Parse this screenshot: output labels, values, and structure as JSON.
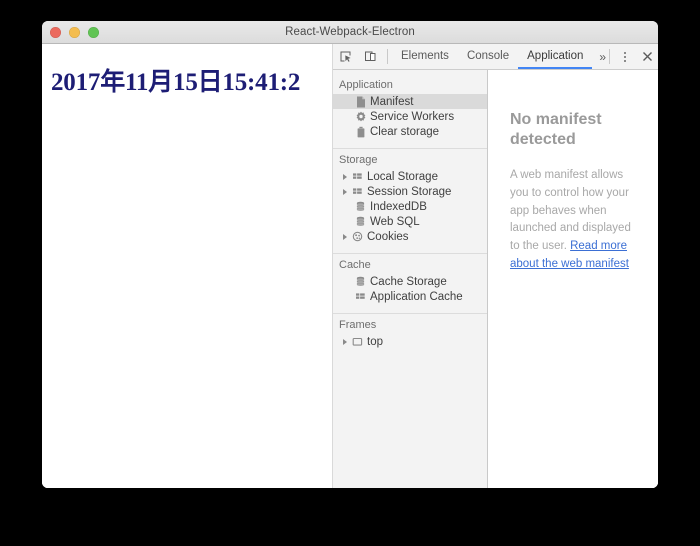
{
  "window": {
    "title": "React-Webpack-Electron",
    "traffic_lights": [
      {
        "name": "close",
        "color": "#eb6a5e"
      },
      {
        "name": "minimize",
        "color": "#f4bd4f"
      },
      {
        "name": "maximize",
        "color": "#61c454"
      }
    ]
  },
  "app": {
    "clock_text": "2017年11月15日15:41:2",
    "clock_color": "#1d1d75"
  },
  "devtools": {
    "toolbar": {
      "inspect_icon": "inspect-element-icon",
      "device_icon": "device-toolbar-icon",
      "more_tabs_label": "»",
      "kebab_label": "more-options",
      "close_label": "✕"
    },
    "tabs": [
      {
        "label": "Elements",
        "active": false
      },
      {
        "label": "Console",
        "active": false
      },
      {
        "label": "Application",
        "active": true
      }
    ],
    "accent_color": "#4285f4",
    "sidebar": [
      {
        "title": "Application",
        "items": [
          {
            "label": "Manifest",
            "icon": "document-icon",
            "arrow": false,
            "selected": true
          },
          {
            "label": "Service Workers",
            "icon": "gear-icon",
            "arrow": false,
            "selected": false
          },
          {
            "label": "Clear storage",
            "icon": "trash-icon",
            "arrow": false,
            "selected": false
          }
        ]
      },
      {
        "title": "Storage",
        "items": [
          {
            "label": "Local Storage",
            "icon": "table-icon",
            "arrow": true,
            "selected": false
          },
          {
            "label": "Session Storage",
            "icon": "table-icon",
            "arrow": true,
            "selected": false
          },
          {
            "label": "IndexedDB",
            "icon": "database-icon",
            "arrow": false,
            "selected": false
          },
          {
            "label": "Web SQL",
            "icon": "database-icon",
            "arrow": false,
            "selected": false
          },
          {
            "label": "Cookies",
            "icon": "cookie-icon",
            "arrow": true,
            "selected": false
          }
        ]
      },
      {
        "title": "Cache",
        "items": [
          {
            "label": "Cache Storage",
            "icon": "database-icon",
            "arrow": false,
            "selected": false
          },
          {
            "label": "Application Cache",
            "icon": "table-icon",
            "arrow": false,
            "selected": false
          }
        ]
      },
      {
        "title": "Frames",
        "items": [
          {
            "label": "top",
            "icon": "frame-icon",
            "arrow": true,
            "selected": false
          }
        ]
      }
    ],
    "content": {
      "empty_title": "No manifest detected",
      "empty_desc_before": "A web manifest allows you to control how your app behaves when launched and displayed to the user. ",
      "empty_desc_link": "Read more about the web manifest"
    }
  }
}
